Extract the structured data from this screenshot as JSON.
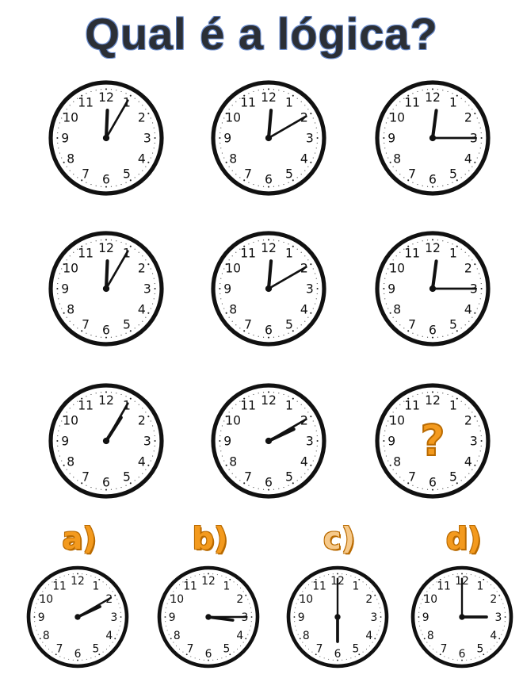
{
  "title": "Qual é a lógica?",
  "colors": {
    "accent": "#f39a1e",
    "accent_dark": "#b96a00",
    "clock_rim": "#111111",
    "title": "#2b2f36"
  },
  "puzzle": {
    "rows": [
      [
        {
          "hour": 12,
          "minute": 5
        },
        {
          "hour": 12,
          "minute": 10
        },
        {
          "hour": 12,
          "minute": 15
        }
      ],
      [
        {
          "hour": 12,
          "minute": 5
        },
        {
          "hour": 12,
          "minute": 10
        },
        {
          "hour": 12,
          "minute": 15
        }
      ],
      [
        {
          "hour": 1,
          "minute": 5
        },
        {
          "hour": 2,
          "minute": 10
        },
        {
          "mystery": true,
          "symbol": "?"
        }
      ]
    ]
  },
  "options": [
    {
      "label": "a)",
      "hour": 2,
      "minute": 10
    },
    {
      "label": "b)",
      "hour": 3,
      "minute": 15
    },
    {
      "label": "c)",
      "hour": 6,
      "minute": 0
    },
    {
      "label": "d)",
      "hour": 3,
      "minute": 0
    }
  ]
}
